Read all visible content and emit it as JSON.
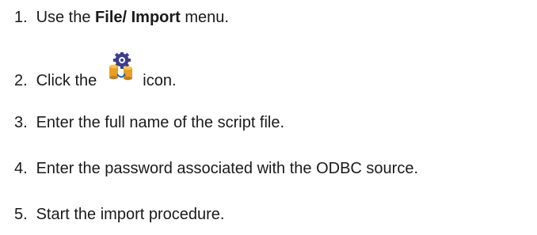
{
  "steps": [
    {
      "number": "1.",
      "text_before": "Use the ",
      "bold": "File/ Import",
      "text_after": " menu."
    },
    {
      "number": "2.",
      "text_before": "Click the",
      "icon": "gear-database-import-icon",
      "text_after": "icon."
    },
    {
      "number": "3.",
      "text": "Enter the full name of the script file."
    },
    {
      "number": "4.",
      "text": "Enter the password associated with the ODBC source."
    },
    {
      "number": "5.",
      "text": "Start the import procedure."
    }
  ]
}
